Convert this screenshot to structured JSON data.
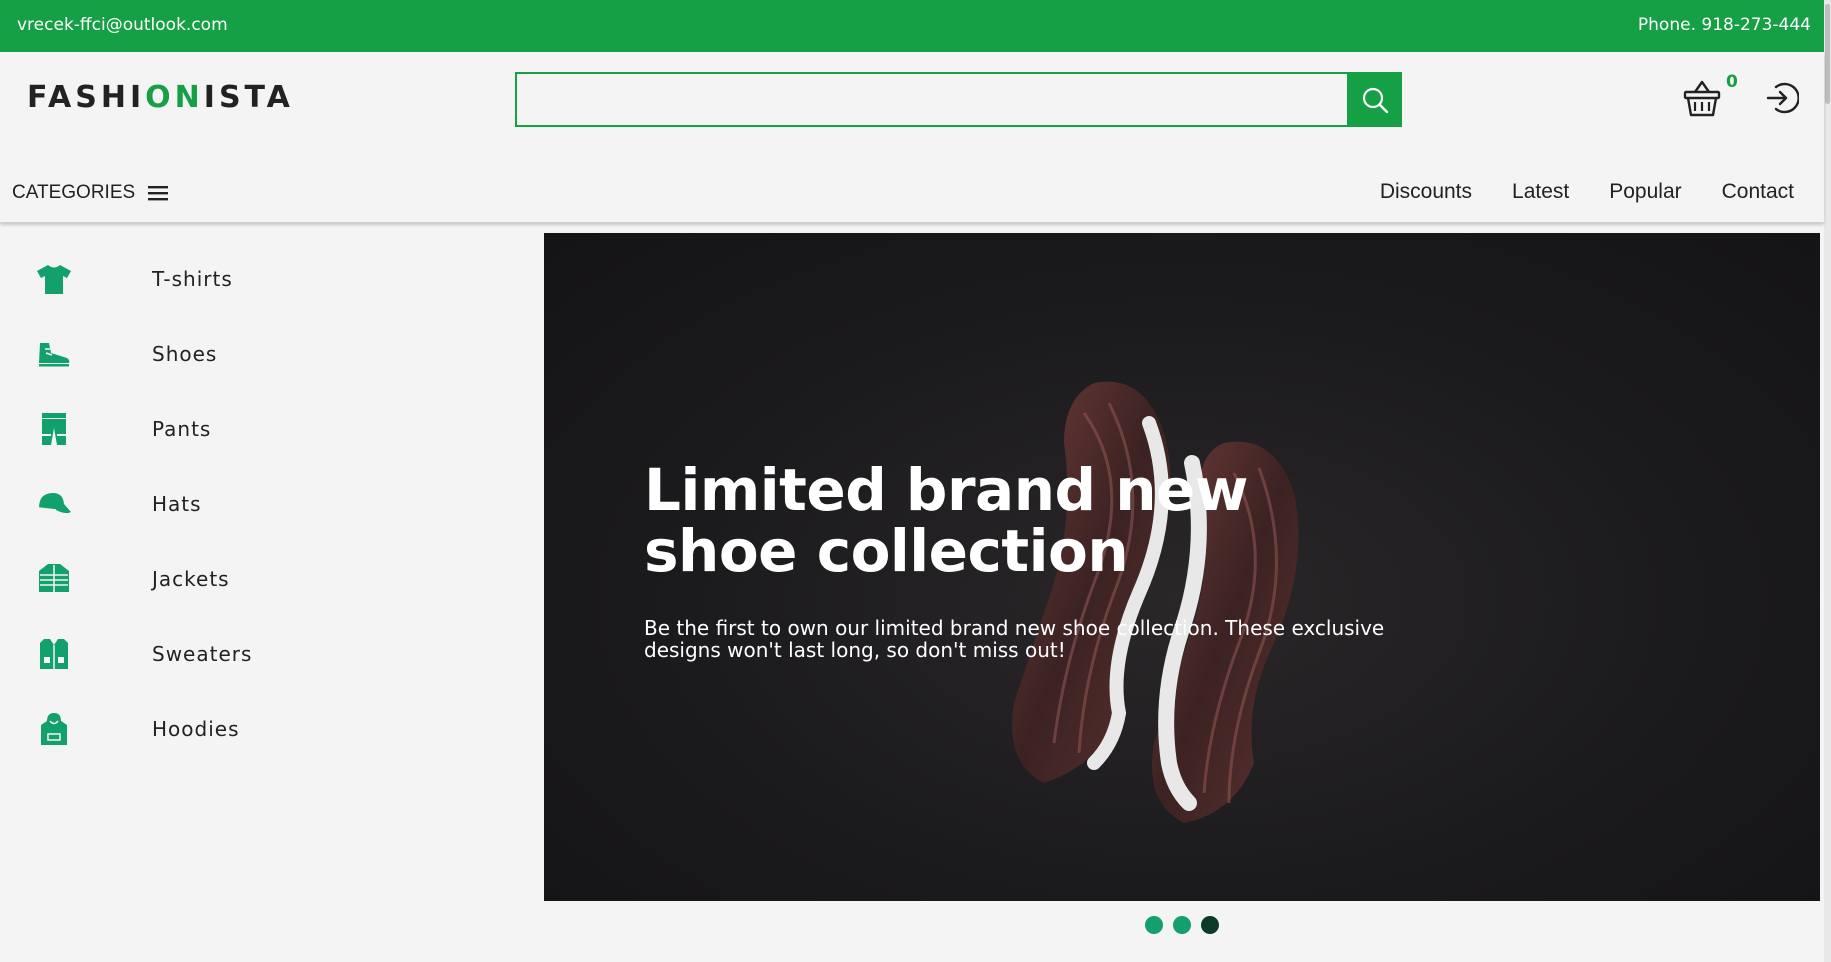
{
  "topbar": {
    "email": "vrecek-ffci@outlook.com",
    "phone": "Phone. 918-273-444"
  },
  "header": {
    "logo_part1": "FASHI",
    "logo_part2": "ON",
    "logo_part3": "ISTA",
    "search_placeholder": "",
    "search_value": "",
    "cart_count": "0",
    "categories_label": "CATEGORIES",
    "nav": [
      "Discounts",
      "Latest",
      "Popular",
      "Contact"
    ]
  },
  "sidebar": {
    "items": [
      {
        "label": "T-shirts",
        "icon": "tshirt-icon"
      },
      {
        "label": "Shoes",
        "icon": "shoe-icon"
      },
      {
        "label": "Pants",
        "icon": "pants-icon"
      },
      {
        "label": "Hats",
        "icon": "cap-icon"
      },
      {
        "label": "Jackets",
        "icon": "jacket-icon"
      },
      {
        "label": "Sweaters",
        "icon": "sweater-icon"
      },
      {
        "label": "Hoodies",
        "icon": "hoodie-icon"
      }
    ]
  },
  "hero": {
    "title": "Limited brand new shoe collection",
    "subtitle": "Be the first to own our limited brand new shoe collection. These exclusive designs won't last long, so don't miss out!",
    "slides": 3,
    "active_slide": 3
  },
  "colors": {
    "brand_green": "#15a046",
    "dot_green": "#12a06c",
    "dot_active": "#0b3a28"
  }
}
